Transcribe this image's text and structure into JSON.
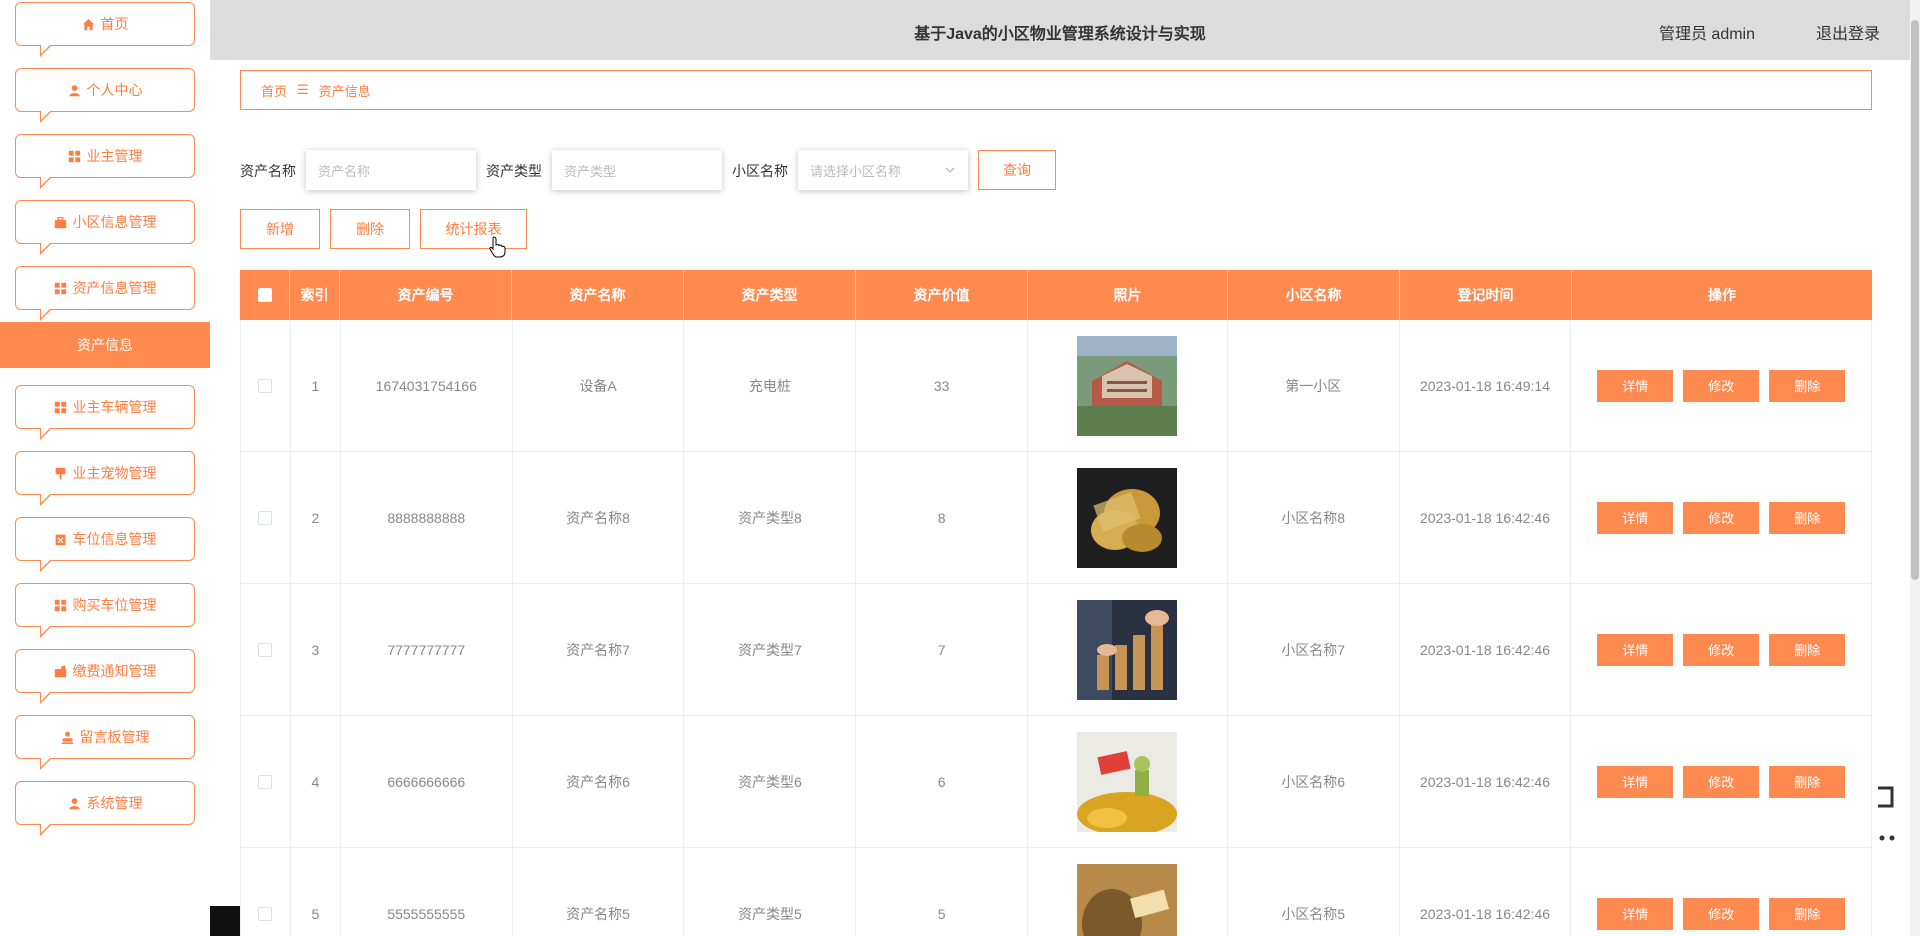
{
  "header": {
    "title": "基于Java的小区物业管理系统设计与实现",
    "user": "管理员 admin",
    "logout": "退出登录"
  },
  "sidebar": {
    "items": [
      {
        "label": "首页",
        "icon": "home-icon"
      },
      {
        "label": "个人中心",
        "icon": "user-icon"
      },
      {
        "label": "业主管理",
        "icon": "grid-icon"
      },
      {
        "label": "小区信息管理",
        "icon": "briefcase-icon"
      },
      {
        "label": "资产信息管理",
        "icon": "grid-icon"
      },
      {
        "label": "业主车辆管理",
        "icon": "grid-icon"
      },
      {
        "label": "业主宠物管理",
        "icon": "pin-icon"
      },
      {
        "label": "车位信息管理",
        "icon": "clipboard-icon"
      },
      {
        "label": "购买车位管理",
        "icon": "grid-icon"
      },
      {
        "label": "缴费通知管理",
        "icon": "wallet-icon"
      },
      {
        "label": "留言板管理",
        "icon": "stamp-icon"
      },
      {
        "label": "系统管理",
        "icon": "user-icon"
      }
    ],
    "active_sub": "资产信息"
  },
  "breadcrumb": {
    "home": "首页",
    "separator": "☰",
    "current": "资产信息"
  },
  "search": {
    "name_label": "资产名称",
    "name_placeholder": "资产名称",
    "type_label": "资产类型",
    "type_placeholder": "资产类型",
    "community_label": "小区名称",
    "community_placeholder": "请选择小区名称",
    "query_button": "查询"
  },
  "actions": {
    "add": "新增",
    "delete": "删除",
    "report": "统计报表"
  },
  "table": {
    "headers": [
      "索引",
      "资产编号",
      "资产名称",
      "资产类型",
      "资产价值",
      "照片",
      "小区名称",
      "登记时间",
      "操作"
    ],
    "op_labels": {
      "detail": "详情",
      "edit": "修改",
      "delete": "删除"
    },
    "rows": [
      {
        "index": "1",
        "code": "1674031754166",
        "name": "设备A",
        "type": "充电桩",
        "value": "33",
        "community": "第一小区",
        "time": "2023-01-18 16:49:14",
        "photo": "building-photo"
      },
      {
        "index": "2",
        "code": "8888888888",
        "name": "资产名称8",
        "type": "资产类型8",
        "value": "8",
        "community": "小区名称8",
        "time": "2023-01-18 16:42:46",
        "photo": "coins-photo"
      },
      {
        "index": "3",
        "code": "7777777777",
        "name": "资产名称7",
        "type": "资产类型7",
        "value": "7",
        "community": "小区名称7",
        "time": "2023-01-18 16:42:46",
        "photo": "coin-stack-photo"
      },
      {
        "index": "4",
        "code": "6666666666",
        "name": "资产名称6",
        "type": "资产类型6",
        "value": "6",
        "community": "小区名称6",
        "time": "2023-01-18 16:42:46",
        "photo": "asset-gold-photo"
      },
      {
        "index": "5",
        "code": "5555555555",
        "name": "资产名称5",
        "type": "资产类型5",
        "value": "5",
        "community": "小区名称5",
        "time": "2023-01-18 16:42:46",
        "photo": "money-bag-photo"
      }
    ]
  },
  "colors": {
    "accent": "#ff8a50",
    "topbar": "#dcdcdc"
  }
}
